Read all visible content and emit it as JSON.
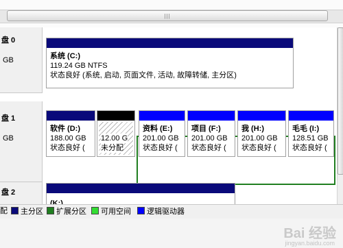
{
  "scroll": {
    "grip": "|||"
  },
  "disks": [
    {
      "name": "盘 0",
      "size": "GB"
    },
    {
      "name": "盘 1",
      "size": "GB"
    },
    {
      "name": "盘 2",
      "size": ""
    }
  ],
  "disk0": {
    "c": {
      "line1": "系统  (C:)",
      "line2": "119.24 GB NTFS",
      "line3": "状态良好 (系统, 启动, 页面文件, 活动, 故障转储, 主分区)"
    }
  },
  "disk1": {
    "d": {
      "line1": "软件  (D:)",
      "line2": "188.00 GB",
      "line3": "状态良好 ("
    },
    "unalloc": {
      "line2": "12.00 G",
      "line3": "未分配"
    },
    "e": {
      "line1": "资料  (E:)",
      "line2": "201.00 GB",
      "line3": "状态良好 ("
    },
    "f": {
      "line1": "项目  (F:)",
      "line2": "201.00 GB",
      "line3": "状态良好 ("
    },
    "h": {
      "line1": "我  (H:)",
      "line2": "201.00 GB",
      "line3": "状态良好 ("
    },
    "i": {
      "line1": "毛毛  (I:)",
      "line2": "128.51 GB",
      "line3": "状态良好 ("
    }
  },
  "disk2": {
    "k": {
      "line1": "(K:)"
    }
  },
  "legend": {
    "partial": "配",
    "primary": "主分区",
    "extended": "扩展分区",
    "free": "可用空间",
    "logical": "逻辑驱动器"
  },
  "colors": {
    "primary": "#0a0a7a",
    "extended": "#1f7e1f",
    "free": "#33dd33",
    "logical": "#0000ff",
    "unallocated": "#000000"
  },
  "watermark": {
    "text": "Bai 经验",
    "url": "jingyan.baidu.com"
  }
}
